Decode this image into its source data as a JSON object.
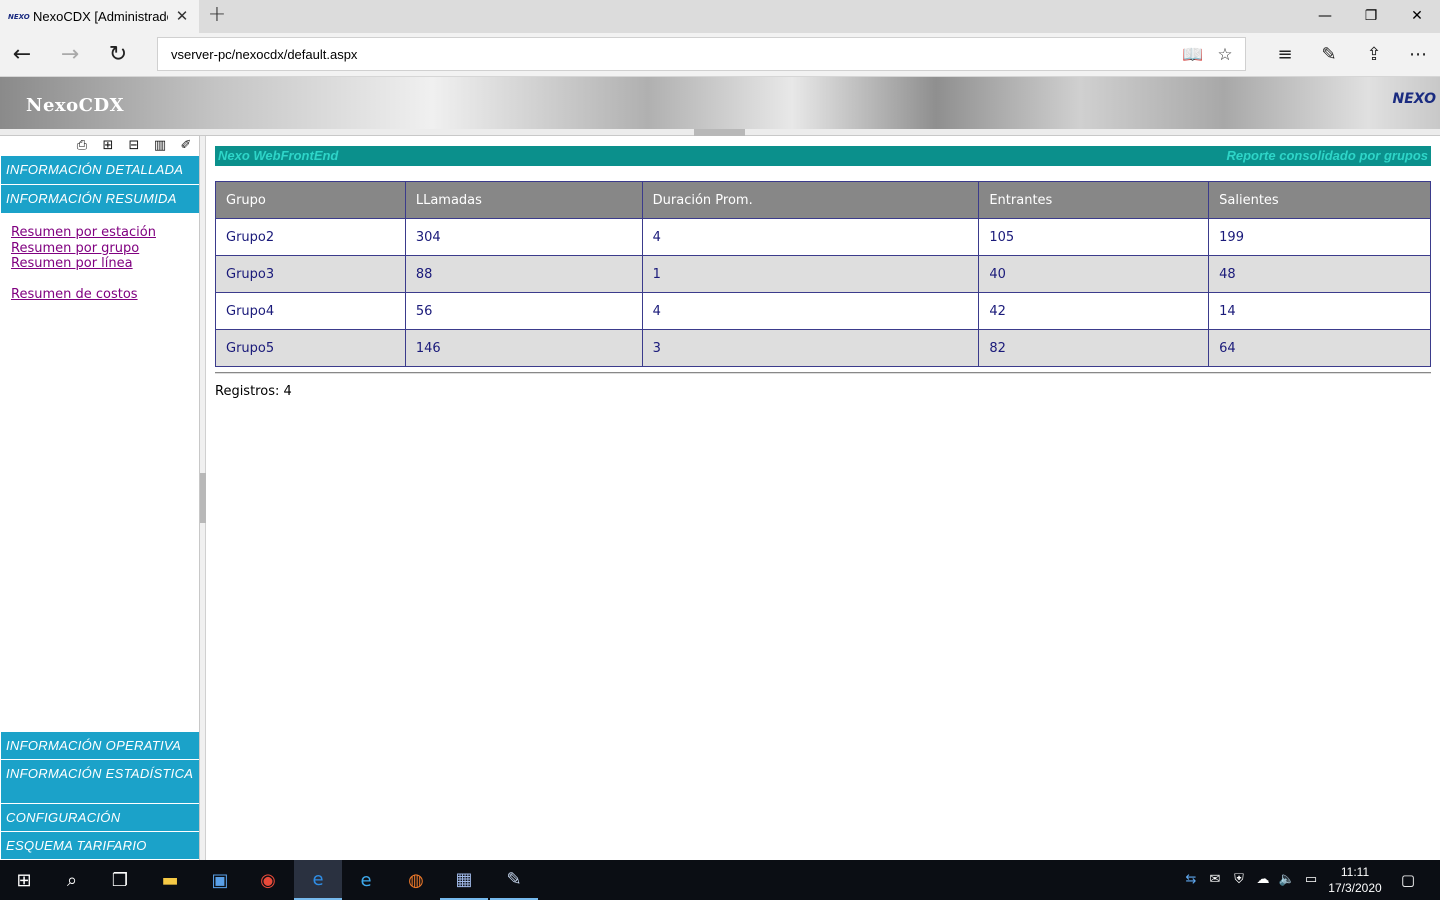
{
  "browser": {
    "tab_title": "NexoCDX [Administrado",
    "tab_favicon": "NEXO",
    "tab_close": "✕",
    "new_tab": "+",
    "minimize": "—",
    "restore": "❐",
    "close": "✕",
    "url": "vserver-pc/nexocdx/default.aspx"
  },
  "header": {
    "title": "NexoCDX",
    "logo": "NEXO"
  },
  "sidebar": {
    "menus_top": [
      {
        "label": "INFORMACIÓN DETALLADA"
      },
      {
        "label": "INFORMACIÓN RESUMIDA"
      }
    ],
    "links": [
      {
        "label": "Resumen por estación"
      },
      {
        "label": "Resumen por grupo"
      },
      {
        "label": "Resumen por línea"
      },
      {
        "label": "Resumen de costos"
      }
    ],
    "menus_bottom": [
      {
        "label": "INFORMACIÓN OPERATIVA"
      },
      {
        "label": "INFORMACIÓN ESTADÍSTICA"
      },
      {
        "label": "CONFIGURACIÓN"
      },
      {
        "label": "ESQUEMA TARIFARIO"
      }
    ]
  },
  "banner": {
    "left": "Nexo WebFrontEnd",
    "right": "Reporte consolidado por grupos"
  },
  "table": {
    "headers": [
      "Grupo",
      "LLamadas",
      "Duración Prom.",
      "Entrantes",
      "Salientes"
    ],
    "rows": [
      [
        "Grupo2",
        "304",
        "4",
        "105",
        "199"
      ],
      [
        "Grupo3",
        "88",
        "1",
        "40",
        "48"
      ],
      [
        "Grupo4",
        "56",
        "4",
        "42",
        "14"
      ],
      [
        "Grupo5",
        "146",
        "3",
        "82",
        "64"
      ]
    ]
  },
  "footer": {
    "registros": "Registros: 4"
  },
  "taskbar": {
    "time": "11:11",
    "date": "17/3/2020"
  }
}
